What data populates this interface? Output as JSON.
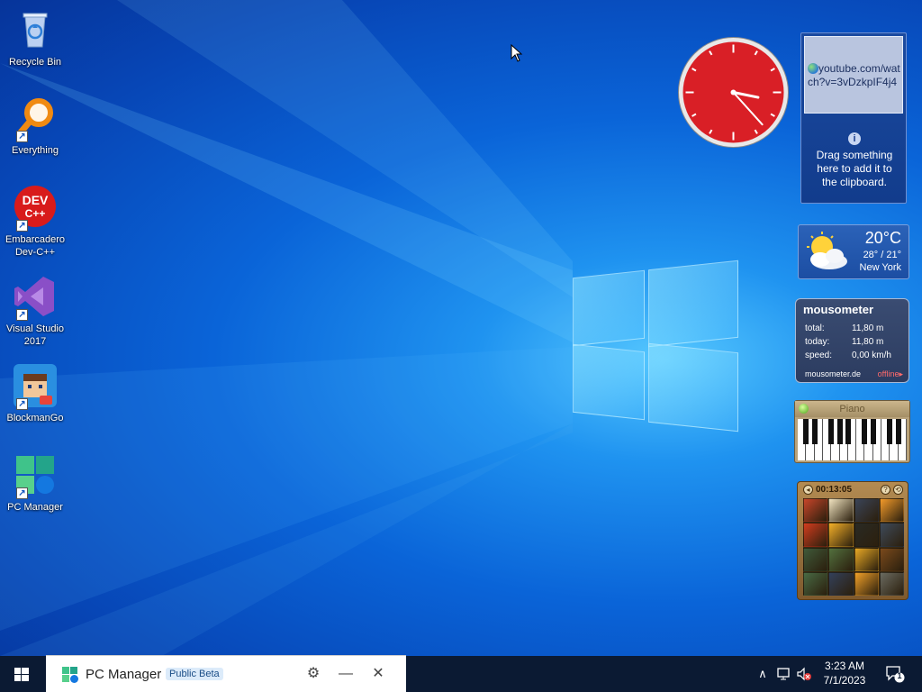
{
  "desktop_icons": [
    {
      "label": "Recycle Bin",
      "icon": "recycle-bin-icon"
    },
    {
      "label": "Everything",
      "icon": "everything-search-icon"
    },
    {
      "label": "Embarcadero Dev-C++",
      "icon": "devcpp-icon",
      "badge_text": "DEV C++"
    },
    {
      "label": "Visual Studio 2017",
      "icon": "visual-studio-icon"
    },
    {
      "label": "BlockmanGo",
      "icon": "blockmango-icon"
    },
    {
      "label": "PC Manager",
      "icon": "pc-manager-icon"
    }
  ],
  "gadgets": {
    "clock": {
      "hour": 3,
      "minute": 23,
      "face_color": "#d91f26"
    },
    "clipboard": {
      "item_text": "youtube.com/watch?v=3vDzkpIF4j4",
      "info_text": "Drag something here to add it to the clipboard."
    },
    "weather": {
      "temp": "20°C",
      "range": "28° / 21°",
      "city": "New York"
    },
    "mousometer": {
      "title": "mousometer",
      "rows": [
        {
          "key": "total:",
          "value": "11,80 m"
        },
        {
          "key": "today:",
          "value": "11,80 m"
        },
        {
          "key": "speed:",
          "value": "0,00 km/h"
        }
      ],
      "footer": "mousometer.de",
      "status": "offline"
    },
    "piano": {
      "title": "Piano"
    },
    "puzzle": {
      "time": "00:13:05",
      "help_label": "?"
    }
  },
  "taskbar": {
    "window": {
      "title": "PC Manager",
      "badge": "Public Beta"
    },
    "time": "3:23 AM",
    "date": "7/1/2023",
    "notification_count": "1"
  },
  "colors": {
    "taskbar": "#0b1a33",
    "clipboard_bg": "#1a4aa0",
    "weather_bg": "#2b62b8",
    "mousometer_bg": "#3a4c72"
  }
}
